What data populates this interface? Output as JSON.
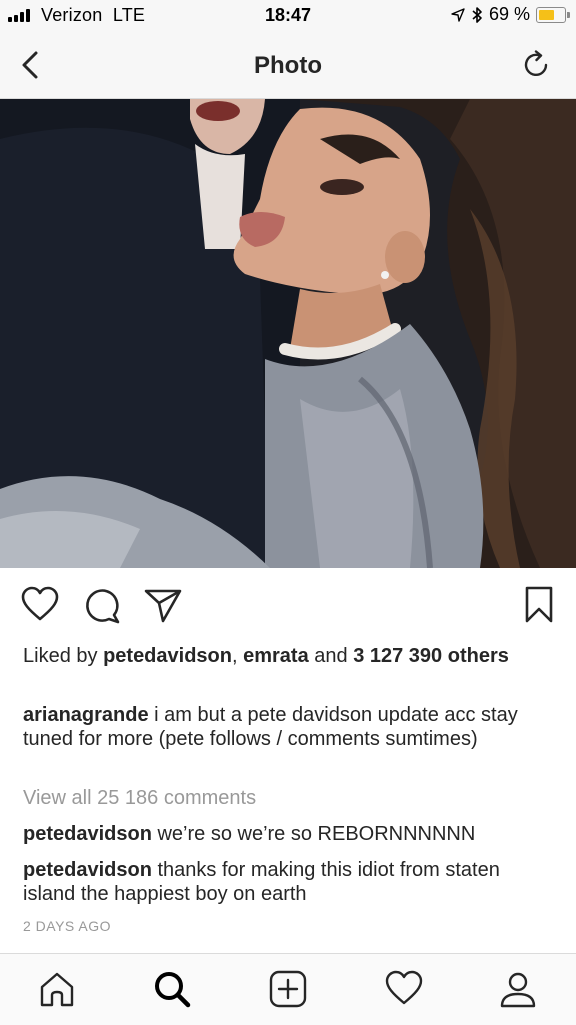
{
  "status_bar": {
    "carrier": "Verizon",
    "network": "LTE",
    "time": "18:47",
    "battery_percent": "69 %",
    "battery_level": 0.69,
    "icons": [
      "signal-icon",
      "location-arrow-icon",
      "bluetooth-icon",
      "battery-icon"
    ]
  },
  "nav": {
    "title": "Photo",
    "back_icon": "chevron-left-icon",
    "refresh_icon": "refresh-icon"
  },
  "post": {
    "image_alt": "Photo of two people",
    "actions": [
      "heart-icon",
      "comment-icon",
      "share-icon",
      "bookmark-icon"
    ],
    "likes": {
      "prefix": "Liked by ",
      "user1": "petedavidson",
      "sep": ", ",
      "user2": "emrata",
      "and": " and ",
      "others": "3 127 390 others"
    },
    "caption": {
      "user": "arianagrande",
      "text": " i am but a pete davidson update acc stay tuned for more (pete follows / comments sumtimes)"
    },
    "view_all": "View all 25 186 comments",
    "comments": [
      {
        "user": "petedavidson",
        "text": " we’re so we’re so REBORNNNNNN"
      },
      {
        "user": "petedavidson",
        "text": " thanks for making this idiot from staten island the happiest boy on earth"
      }
    ],
    "time_ago": "2 DAYS AGO"
  },
  "tab_bar": {
    "items": [
      "home-icon",
      "search-icon",
      "add-post-icon",
      "activity-heart-icon",
      "profile-icon"
    ]
  },
  "colors": {
    "text": "#262626",
    "muted": "#999999",
    "bar_bg": "#f7f7f7",
    "battery": "#f5c018"
  }
}
